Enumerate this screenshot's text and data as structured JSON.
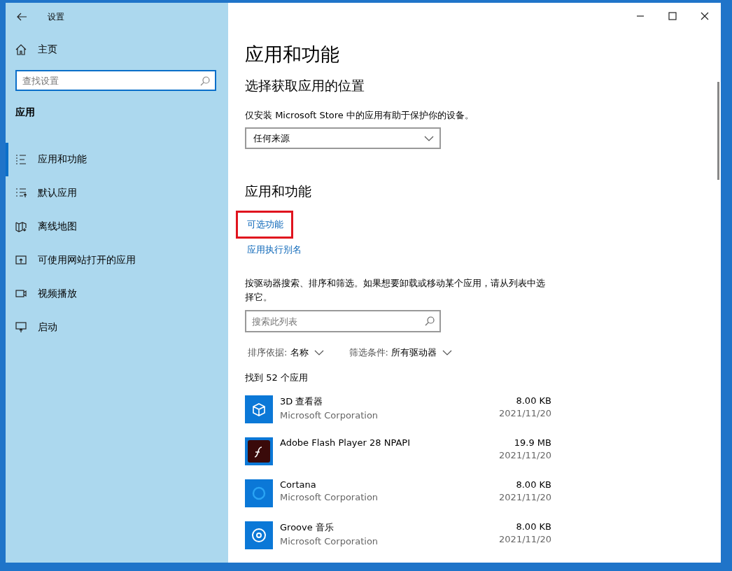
{
  "window": {
    "title": "设置"
  },
  "sidebar": {
    "home": "主页",
    "search": {
      "placeholder": "查找设置"
    },
    "section": "应用",
    "items": [
      {
        "label": "应用和功能",
        "selected": true
      },
      {
        "label": "默认应用",
        "selected": false
      },
      {
        "label": "离线地图",
        "selected": false
      },
      {
        "label": "可使用网站打开的应用",
        "selected": false
      },
      {
        "label": "视频播放",
        "selected": false
      },
      {
        "label": "启动",
        "selected": false
      }
    ]
  },
  "main": {
    "title": "应用和功能",
    "install_source": {
      "heading": "选择获取应用的位置",
      "note": "仅安装 Microsoft Store 中的应用有助于保护你的设备。",
      "dropdown": "任何来源"
    },
    "apps_section": {
      "heading": "应用和功能",
      "links": [
        {
          "label": "可选功能",
          "highlighted": true
        },
        {
          "label": "应用执行别名",
          "highlighted": false
        }
      ],
      "description": "按驱动器搜索、排序和筛选。如果想要卸载或移动某个应用，请从列表中选择它。",
      "search": {
        "placeholder": "搜索此列表"
      },
      "sort": {
        "label": "排序依据:",
        "value": "名称"
      },
      "filter": {
        "label": "筛选条件:",
        "value": "所有驱动器"
      },
      "count": "找到 52 个应用",
      "apps": [
        {
          "name": "3D 查看器",
          "publisher": "Microsoft Corporation",
          "size": "8.00 KB",
          "date": "2021/11/20"
        },
        {
          "name": "Adobe Flash Player 28 NPAPI",
          "size": "19.9 MB",
          "date": "2021/11/20"
        },
        {
          "name": "Cortana",
          "publisher": "Microsoft Corporation",
          "size": "8.00 KB",
          "date": "2021/11/20"
        },
        {
          "name": "Groove 音乐",
          "publisher": "Microsoft Corporation",
          "size": "8.00 KB",
          "date": "2021/11/20"
        }
      ]
    }
  }
}
